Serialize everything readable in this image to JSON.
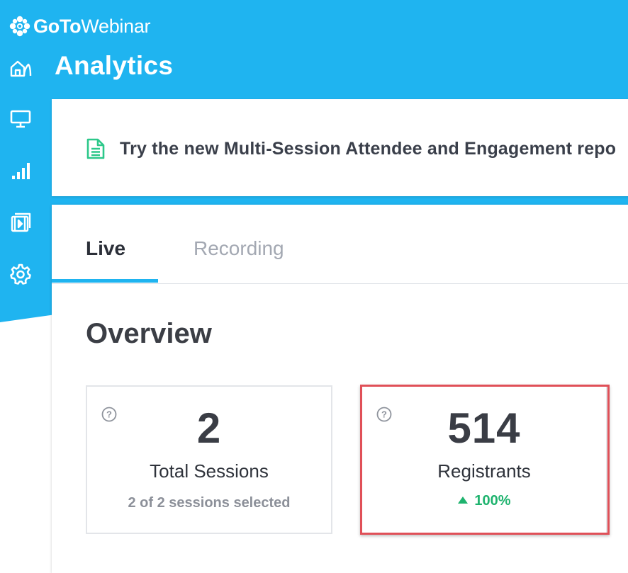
{
  "brand": {
    "bold": "GoTo",
    "regular": "Webinar"
  },
  "page": {
    "title": "Analytics"
  },
  "nav": {
    "items": [
      "home-icon",
      "monitor-icon",
      "analytics-icon",
      "recordings-icon",
      "settings-icon"
    ]
  },
  "banner": {
    "text": "Try the new Multi-Session Attendee and Engagement repo"
  },
  "tabs": [
    {
      "label": "Live",
      "active": true
    },
    {
      "label": "Recording",
      "active": false
    }
  ],
  "overview": {
    "title": "Overview",
    "cards": [
      {
        "value": "2",
        "label": "Total Sessions",
        "sub": "2 of 2 sessions selected"
      },
      {
        "value": "514",
        "label": "Registrants",
        "trend": "100%"
      }
    ]
  },
  "colors": {
    "brand_blue": "#1fb4f0",
    "positive_green": "#1eb36e",
    "highlight_red": "#e05058",
    "banner_icon_green": "#2cc88a"
  }
}
